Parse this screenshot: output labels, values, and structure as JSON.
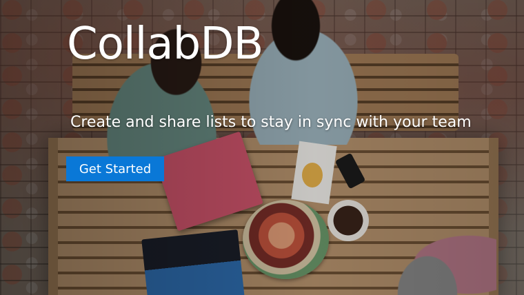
{
  "hero": {
    "title": "CollabDB",
    "tagline": "Create and share lists to stay in sync with your team",
    "cta_label": "Get Started"
  },
  "colors": {
    "cta_background": "#0a78d7",
    "text": "#ffffff"
  }
}
